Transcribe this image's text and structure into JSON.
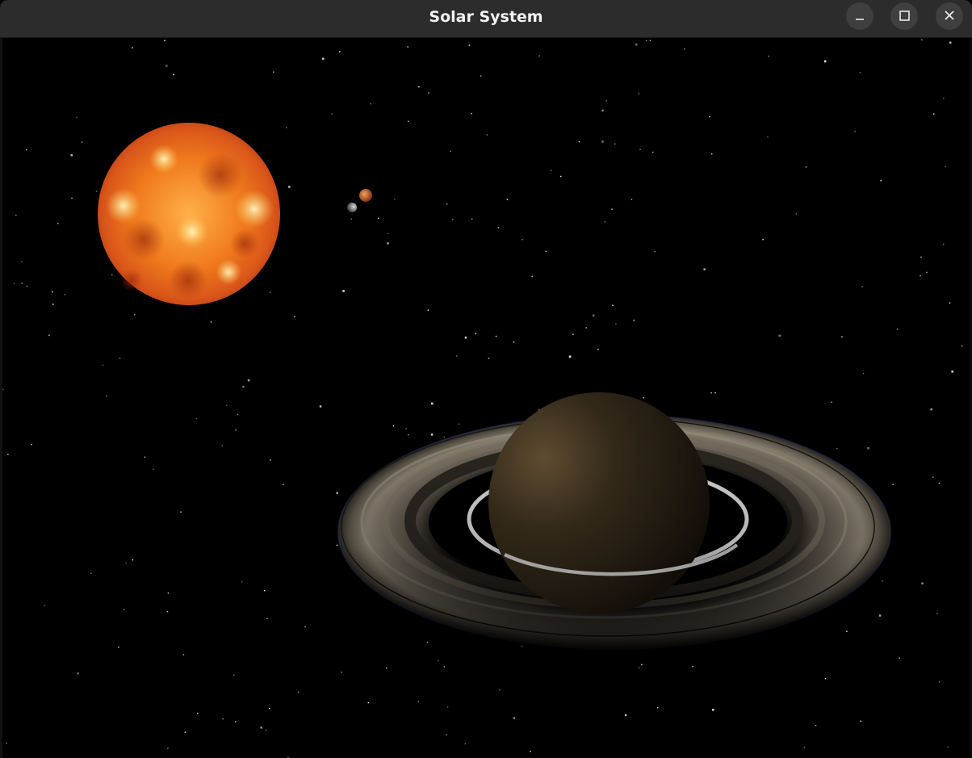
{
  "window": {
    "title": "Solar System",
    "controls": {
      "minimize_icon": "minimize-icon",
      "maximize_icon": "maximize-icon",
      "close_icon": "close-icon"
    }
  },
  "scene": {
    "background_color": "#000000",
    "bodies": [
      {
        "name": "sun",
        "colors": [
          "#fff1a0",
          "#ff9a2a",
          "#c2410c"
        ]
      },
      {
        "name": "mars",
        "colors": [
          "#e08a4a",
          "#a0441a"
        ]
      },
      {
        "name": "moon",
        "colors": [
          "#c8c8c8",
          "#6a6a6a"
        ]
      },
      {
        "name": "saturn",
        "colors": [
          "#5b4a30",
          "#1c160d"
        ]
      },
      {
        "name": "saturn-rings",
        "colors": [
          "#8c8070",
          "#3a342c",
          "#d8d8d8"
        ]
      }
    ]
  }
}
